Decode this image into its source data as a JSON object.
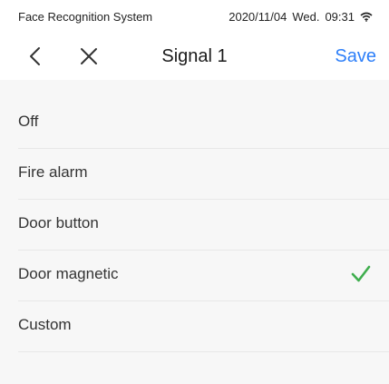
{
  "status_bar": {
    "app_name": "Face Recognition System",
    "date": "2020/11/04",
    "weekday": "Wed.",
    "time": "09:31",
    "wifi_icon": "wifi-icon"
  },
  "nav": {
    "back_icon": "chevron-left-icon",
    "close_icon": "close-icon",
    "title": "Signal 1",
    "save_label": "Save",
    "accent_color": "#2d7ff9"
  },
  "options": [
    {
      "label": "Off",
      "selected": false
    },
    {
      "label": "Fire alarm",
      "selected": false
    },
    {
      "label": "Door button",
      "selected": false
    },
    {
      "label": "Door magnetic",
      "selected": true
    },
    {
      "label": "Custom",
      "selected": false
    }
  ],
  "check_color": "#3fae4e"
}
